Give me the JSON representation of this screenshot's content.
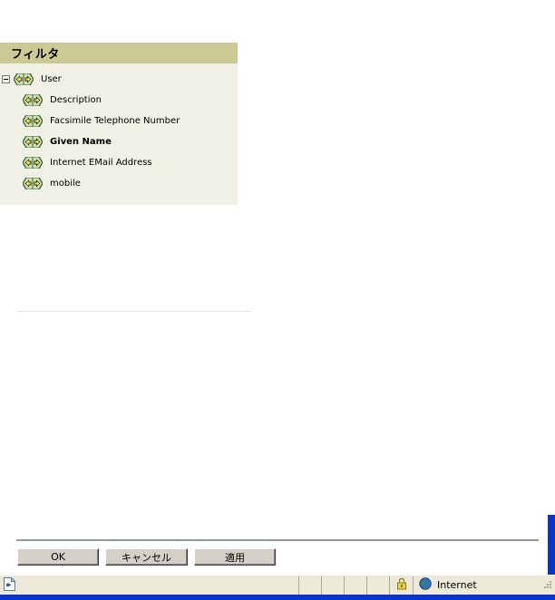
{
  "panel": {
    "title": "フィルタ",
    "header_bg": "#ccca94",
    "body_bg": "#f0f0e5",
    "root": {
      "label": "User",
      "icon": "double-arrow-icon",
      "expander": "collapse-minus-icon",
      "bold": false
    },
    "items": [
      {
        "label": "Description",
        "icon": "double-arrow-icon",
        "bold": false
      },
      {
        "label": "Facsimile Telephone Number",
        "icon": "double-arrow-icon",
        "bold": false
      },
      {
        "label": "Given Name",
        "icon": "double-arrow-icon",
        "bold": true
      },
      {
        "label": "Internet EMail Address",
        "icon": "double-arrow-icon",
        "bold": false
      },
      {
        "label": "mobile",
        "icon": "double-arrow-icon",
        "bold": false
      }
    ]
  },
  "buttons": {
    "ok": "OK",
    "cancel": "キャンセル",
    "apply": "適用"
  },
  "status_bar": {
    "page_icon": "page-document-icon",
    "lock_icon": "padlock-secure-icon",
    "zone_icon": "globe-internet-icon",
    "zone_label": "Internet",
    "grip_icon": "resize-grip-icon"
  },
  "colors": {
    "header_khaki": "#ccca94",
    "panel_cream": "#f0f0e5",
    "frame_blue": "#0a36c8",
    "button_face": "#d4d0c8",
    "status_face": "#ece9d8",
    "rule_blue_gray": "#8d9aaa",
    "icon_green": "#3f6b3f",
    "icon_yellow": "#f2ee50"
  }
}
